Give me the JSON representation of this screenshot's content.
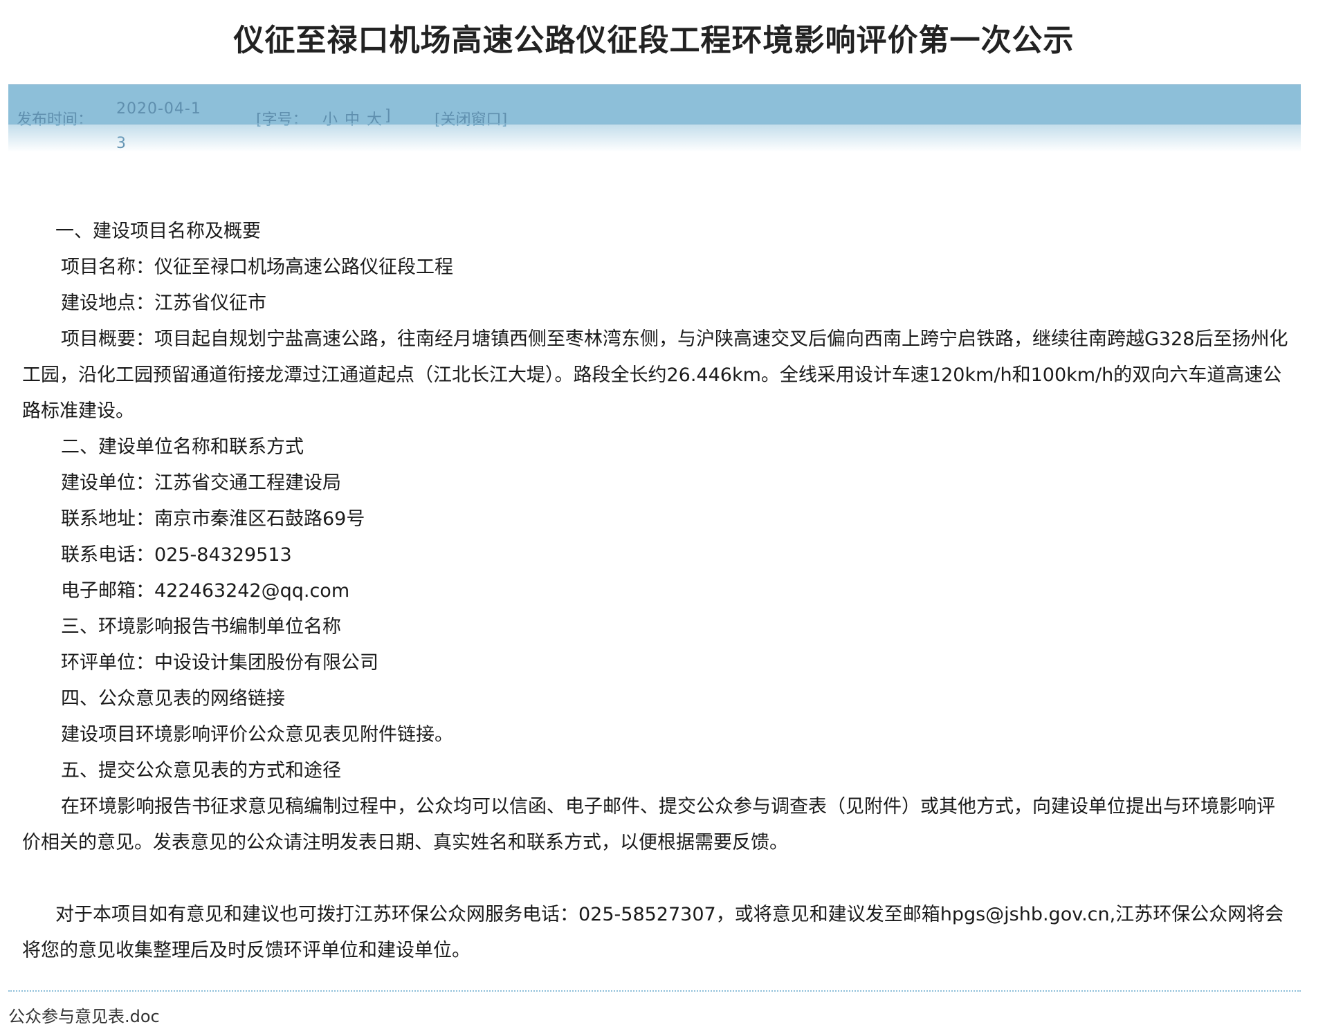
{
  "title": "仪征至禄口机场高速公路仪征段工程环境影响评价第一次公示",
  "info_bar": {
    "publish_label": "发布时间：",
    "publish_date": "2020-04-13",
    "font_size_label": "[字号：",
    "font_small": "小",
    "font_medium": "中",
    "font_large": "大",
    "font_size_end": "]",
    "close_window": "[关闭窗口]"
  },
  "body": {
    "s1_heading": "一、建设项目名称及概要",
    "project_name": "项目名称：仪征至禄口机场高速公路仪征段工程",
    "location": "建设地点：江苏省仪征市",
    "summary": "项目概要：项目起自规划宁盐高速公路，往南经月塘镇西侧至枣林湾东侧，与沪陕高速交叉后偏向西南上跨宁启铁路，继续往南跨越G328后至扬州化工园，沿化工园预留通道衔接龙潭过江通道起点（江北长江大堤）。路段全长约26.446km。全线采用设计车速120km/h和100km/h的双向六车道高速公路标准建设。",
    "s2_heading": "二、建设单位名称和联系方式",
    "unit": "建设单位：江苏省交通工程建设局",
    "address": "联系地址：南京市秦淮区石鼓路69号",
    "phone": "联系电话：025-84329513",
    "email": "电子邮箱：422463242@qq.com",
    "s3_heading": "三、环境影响报告书编制单位名称",
    "eia_unit": "环评单位：中设设计集团股份有限公司",
    "s4_heading": "四、公众意见表的网络链接",
    "link_text": "建设项目环境影响评价公众意见表见附件链接。",
    "s5_heading": "五、提交公众意见表的方式和途径",
    "s5_text": "在环境影响报告书征求意见稿编制过程中，公众均可以信函、电子邮件、提交公众参与调查表（见附件）或其他方式，向建设单位提出与环境影响评价相关的意见。发表意见的公众请注明发表日期、真实姓名和联系方式，以便根据需要反馈。",
    "closing": "对于本项目如有意见和建议也可拨打江苏环保公众网服务电话：025-58527307，或将意见和建议发至邮箱hpgs@jshb.gov.cn,江苏环保公众网将会将您的意见收集整理后及时反馈环评单位和建设单位。"
  },
  "attachment": "公众参与意见表.doc"
}
